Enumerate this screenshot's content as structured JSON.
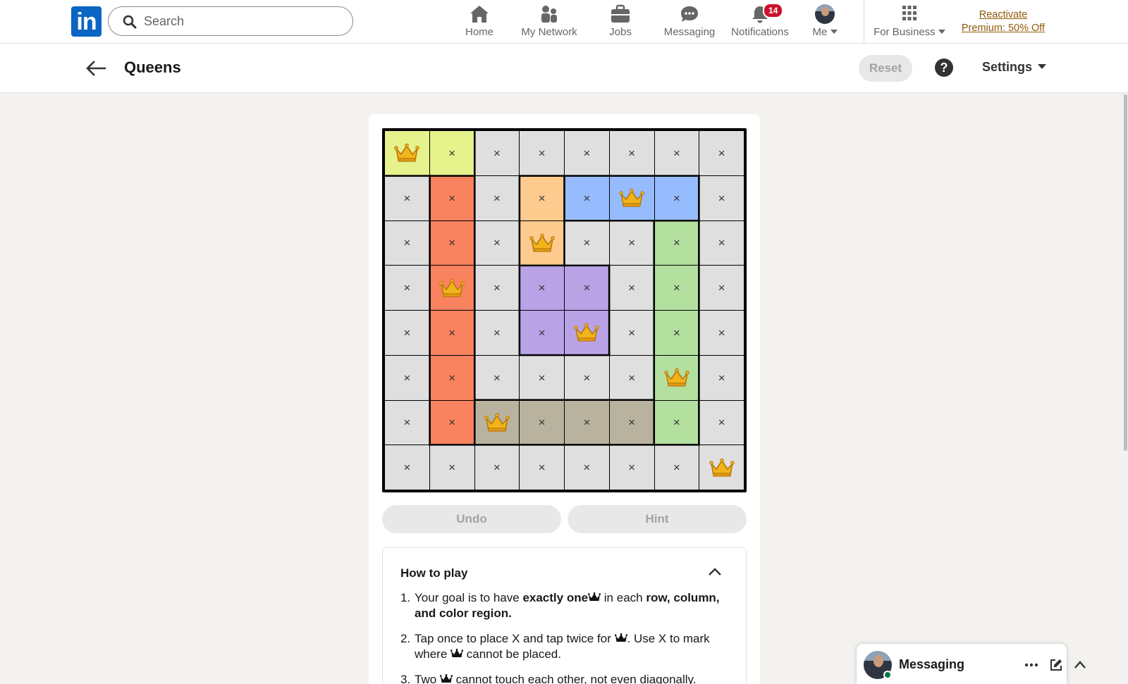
{
  "nav": {
    "logo_text": "in",
    "search_placeholder": "Search",
    "items": [
      {
        "label": "Home",
        "icon": "home-icon"
      },
      {
        "label": "My Network",
        "icon": "network-icon"
      },
      {
        "label": "Jobs",
        "icon": "briefcase-icon"
      },
      {
        "label": "Messaging",
        "icon": "chat-icon"
      },
      {
        "label": "Notifications",
        "icon": "bell-icon",
        "badge": "14"
      },
      {
        "label": "Me",
        "icon": "avatar"
      },
      {
        "label": "For Business",
        "icon": "grid-icon"
      }
    ],
    "premium_line1": "Reactivate",
    "premium_line2": "Premium: 50% Off"
  },
  "header": {
    "title": "Queens",
    "reset_label": "Reset",
    "help_label": "?",
    "settings_label": "Settings"
  },
  "game": {
    "size": 8,
    "colors": {
      "Y": "#e6f28c",
      "R": "#f9825f",
      "G": "#dfdfdf",
      "O": "#fdcb8e",
      "B": "#97bcfe",
      "L": "#b3df9f",
      "P": "#b9a2e6",
      "T": "#b9b29e"
    },
    "regions": [
      "YYGGGGGG",
      "GRGOBBBG",
      "GRGOGGLG",
      "GRGPPGLG",
      "GRGPPGLG",
      "GRGGGGLG",
      "GRTTTTLG",
      "GGGGGGGG"
    ],
    "state": [
      "QXXXXXXX",
      "XXXXXQXX",
      "XXXQXXXX",
      "XQXXXXXX",
      "XXXXQXXX",
      "XXXXXXQX",
      "XXQXXXXX",
      "XXXXXXXQ"
    ],
    "x_symbol": "×",
    "undo_label": "Undo",
    "hint_label": "Hint"
  },
  "howto": {
    "title": "How to play",
    "rules": [
      {
        "num": "1.",
        "parts": [
          {
            "t": "Your goal is to have "
          },
          {
            "t": "exactly one",
            "b": true
          },
          {
            "t": " ",
            "crown": true
          },
          {
            "t": " in each "
          },
          {
            "t": "row, column, and color region.",
            "b": true
          }
        ]
      },
      {
        "num": "2.",
        "parts": [
          {
            "t": "Tap once to place X and tap twice for "
          },
          {
            "t": "",
            "crown": true
          },
          {
            "t": ". Use X to mark where "
          },
          {
            "t": "",
            "crown": true
          },
          {
            "t": " cannot be placed."
          }
        ]
      },
      {
        "num": "3.",
        "parts": [
          {
            "t": "Two "
          },
          {
            "t": "",
            "crown": true
          },
          {
            "t": " cannot touch each other, not even diagonally."
          }
        ]
      }
    ]
  },
  "messaging": {
    "title": "Messaging"
  }
}
